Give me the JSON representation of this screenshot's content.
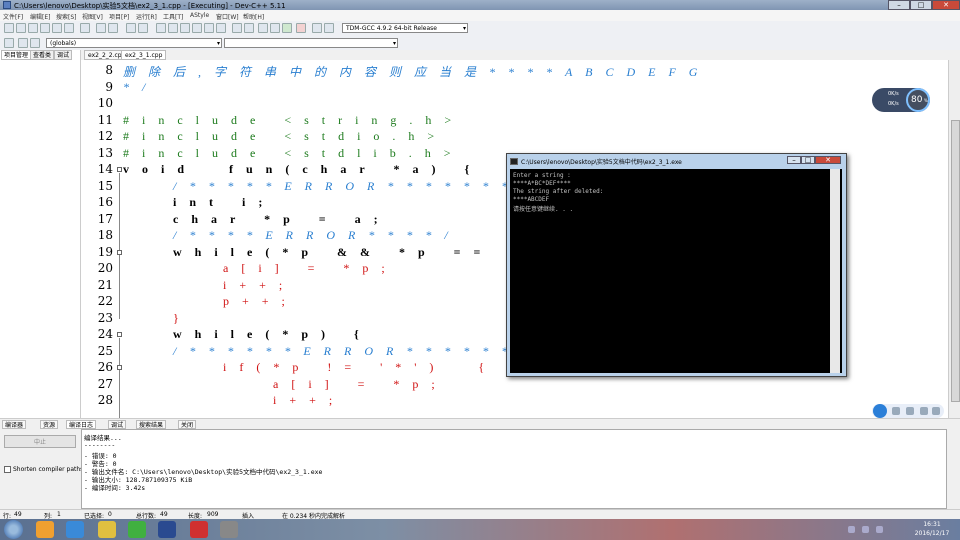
{
  "window": {
    "title": "C:\\Users\\lenovo\\Desktop\\实验5文档\\ex2_3_1.cpp - [Executing] - Dev-C++ 5.11"
  },
  "menu": {
    "items": [
      "文件[F]",
      "编辑[E]",
      "搜索[S]",
      "视图[V]",
      "项目[P]",
      "运行[R]",
      "工具[T]",
      "AStyle",
      "窗口[W]",
      "帮助[H]"
    ]
  },
  "toolbar": {
    "compiler": "TDM-GCC 4.9.2 64-bit Release",
    "scope": "(globals)"
  },
  "left_panel": {
    "tabs": [
      "项目管理",
      "查看类",
      "调试"
    ]
  },
  "editor": {
    "tabs": [
      "ex2_2_2.cpp",
      "ex2_3_1.cpp"
    ],
    "line_numbers": [
      "8",
      "9",
      "10",
      "11",
      "12",
      "13",
      "14",
      "15",
      "16",
      "17",
      "18",
      "19",
      "20",
      "21",
      "22",
      "23",
      "24",
      "25",
      "26",
      "27",
      "28"
    ],
    "lines": [
      "删 除 后 , 字 符 串 中 的 内 容 则 应 当 是 * * * * A B C D E F G",
      "* /",
      "",
      "# i n c l u d e   < s t r i n g . h >",
      "# i n c l u d e   < s t d i o . h >",
      "# i n c l u d e   < s t d l i b . h >",
      "v o i d     f u n ( c h a r   * a )   {",
      "/ * * * * * E R R O R * * * * * * * * /",
      "i n t   i ;",
      "c h a r   * p   =   a ;",
      "/ * * * * E R R O R * * * * /",
      "w h i l e ( * p   & &   * p   = =   ' * ' )   {",
      "a [ i ]   =   * p ;",
      "i + + ;",
      "p + + ;",
      "}",
      "w h i l e ( * p )   {",
      "/ * * * * * * E R R O R * * * * * * * /",
      "i f ( * p   ! =   ' * ' )     {",
      "a [ i ]   =   * p ;",
      "i + + ;"
    ]
  },
  "console": {
    "title": "C:\\Users\\lenovo\\Desktop\\实验5文档中代码\\ex2_3_1.exe",
    "lines": [
      "Enter a string :",
      "****A*BC*DEF****",
      "The string after deleted:",
      "****ABCDEF",
      "请按任意键继续. . . "
    ]
  },
  "bottom_tabs": [
    "编译器",
    "资源",
    "编译日志",
    "调试",
    "搜索结果",
    "关闭"
  ],
  "compile": {
    "abort_label": "中止",
    "shorten_label": "Shorten compiler paths",
    "log": [
      "编译结果...",
      "--------",
      "- 错误: 0",
      "- 警告: 0",
      "- 输出文件名: C:\\Users\\lenovo\\Desktop\\实验5文档中代码\\ex2_3_1.exe",
      "- 输出大小: 128.787109375 KiB",
      "- 编译时间: 3.42s"
    ]
  },
  "status": {
    "row_label": "行:",
    "row": "49",
    "col_label": "列:",
    "col": "1",
    "sel_label": "已选择:",
    "sel": "0",
    "lines_label": "总行数:",
    "lines": "49",
    "len_label": "长度:",
    "len": "909",
    "mode": "插入",
    "parse": "在 0.234 秒内完成解析"
  },
  "widget": {
    "percent": "80",
    "percent_unit": "%",
    "up": "0K/s",
    "down": "0K/s"
  },
  "taskbar": {
    "time": "16:31",
    "date": "2016/12/17"
  },
  "colors": {
    "comment": "#2a7fd0",
    "preprocessor": "#1b7a1b",
    "operator": "#d01010"
  }
}
